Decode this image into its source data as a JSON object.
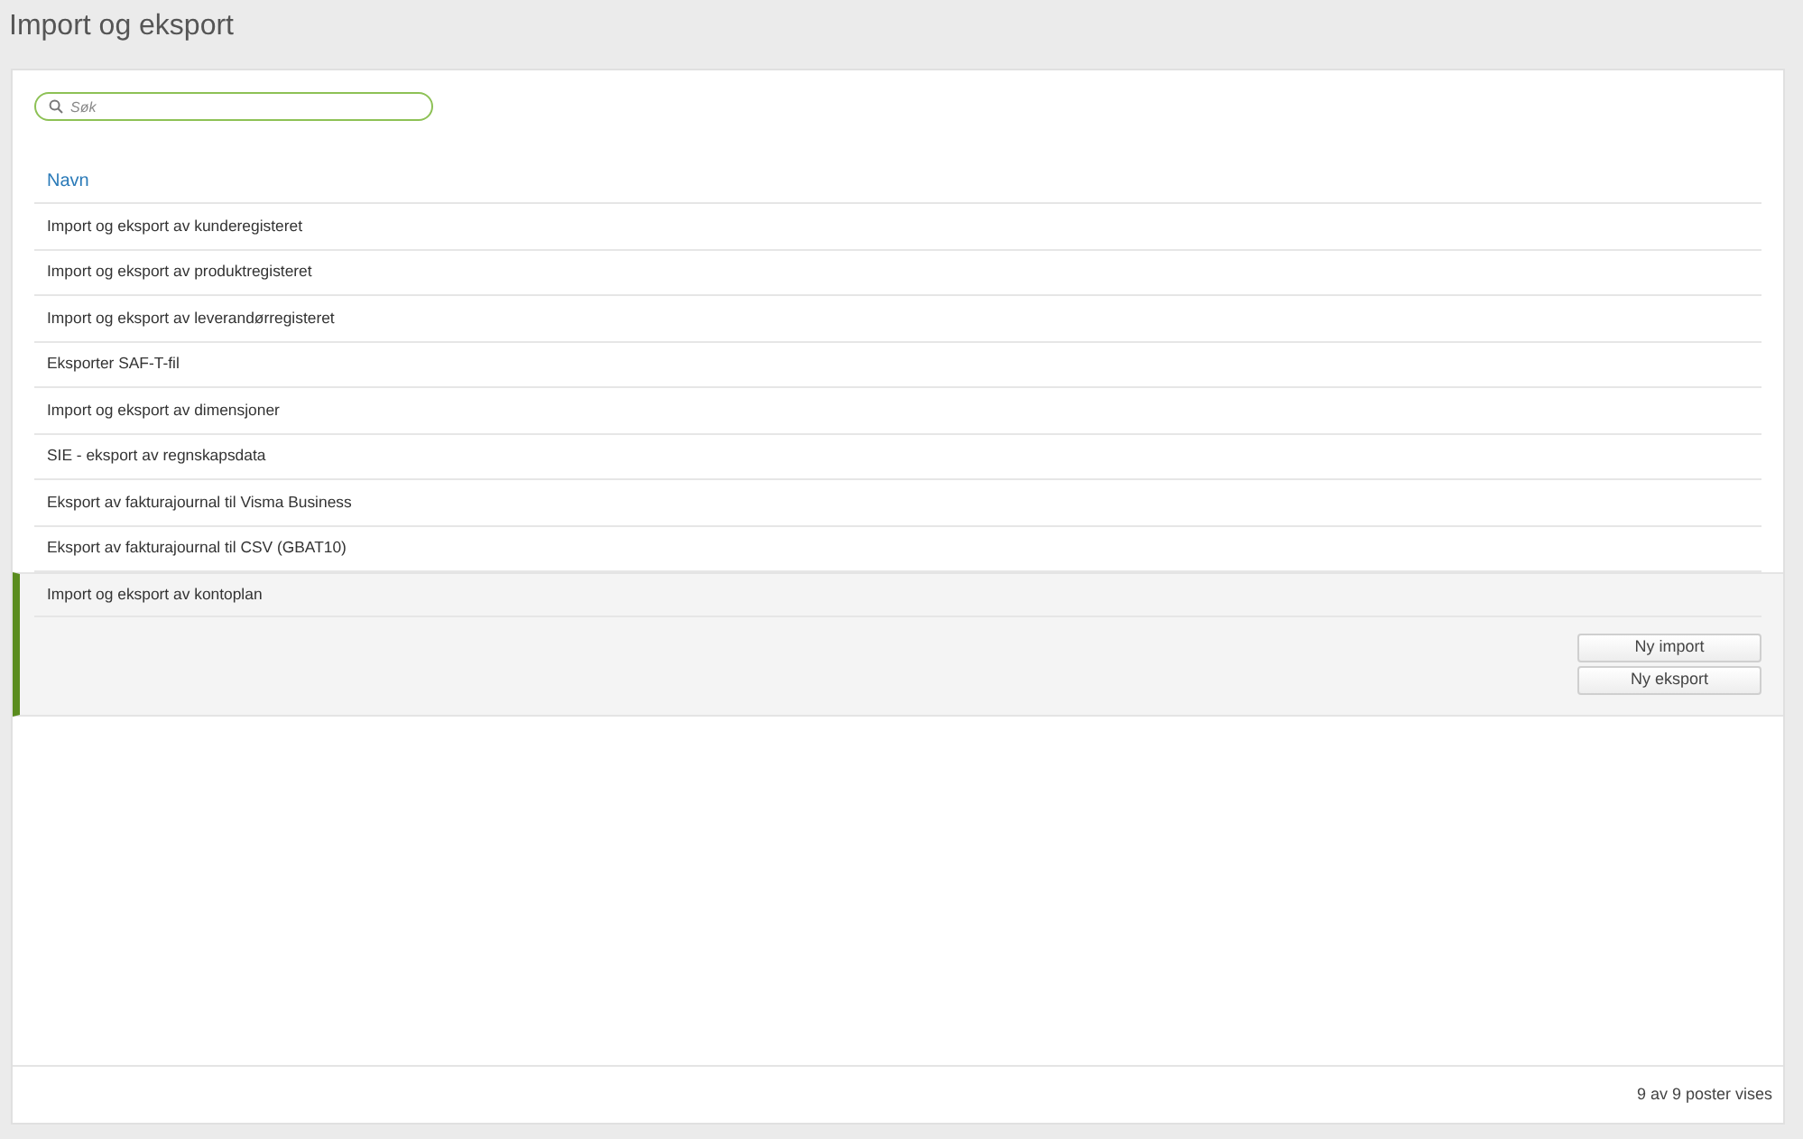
{
  "page": {
    "title": "Import og eksport"
  },
  "search": {
    "placeholder": "Søk"
  },
  "table": {
    "columns": [
      "Navn"
    ],
    "rows": [
      {
        "name": "Import og eksport av kunderegisteret",
        "selected": false
      },
      {
        "name": "Import og eksport av produktregisteret",
        "selected": false
      },
      {
        "name": "Import og eksport av leverandørregisteret",
        "selected": false
      },
      {
        "name": "Eksporter SAF-T-fil",
        "selected": false
      },
      {
        "name": "Import og eksport av dimensjoner",
        "selected": false
      },
      {
        "name": "SIE - eksport av regnskapsdata",
        "selected": false
      },
      {
        "name": "Eksport av fakturajournal til Visma Business",
        "selected": false
      },
      {
        "name": "Eksport av fakturajournal til CSV (GBAT10)",
        "selected": false
      },
      {
        "name": "Import og eksport av kontoplan",
        "selected": true,
        "actions": [
          "Ny import",
          "Ny eksport"
        ]
      }
    ]
  },
  "status_bar": {
    "text": "9 av 9 poster vises"
  }
}
